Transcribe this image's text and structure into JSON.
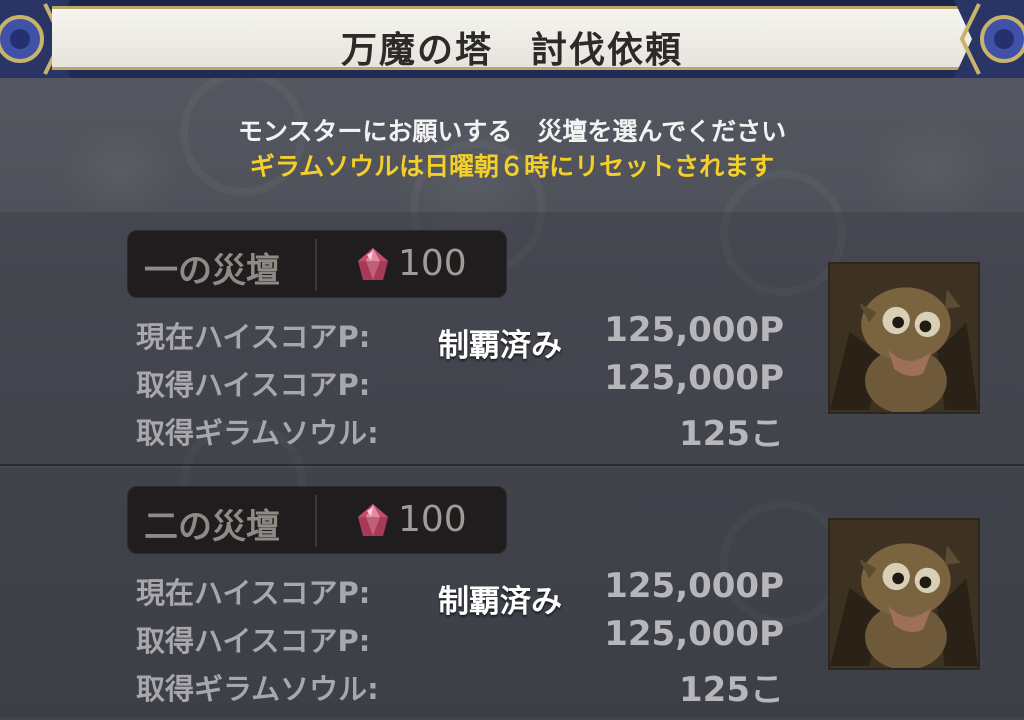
{
  "title": "万魔の塔　討伐依頼",
  "messages": {
    "instruction": "モンスターにお願いする　災壇を選んでください",
    "reset_notice": "ギラムソウルは日曜朝６時にリセットされます"
  },
  "icons": {
    "currency": "pink-gem-icon",
    "portrait": "monster-portrait"
  },
  "colors": {
    "notice": "#f4cf2a",
    "title_frame": "#222b57",
    "gold_trim": "#b9a766"
  },
  "altars": [
    {
      "name": "一の災壇",
      "cost": "100",
      "status": "制覇済み",
      "rows": [
        {
          "label": "現在ハイスコアP:",
          "value": "125,000P"
        },
        {
          "label": "取得ハイスコアP:",
          "value": "125,000P"
        },
        {
          "label": "取得ギラムソウル:",
          "value": "125こ"
        }
      ]
    },
    {
      "name": "二の災壇",
      "cost": "100",
      "status": "制覇済み",
      "rows": [
        {
          "label": "現在ハイスコアP:",
          "value": "125,000P"
        },
        {
          "label": "取得ハイスコアP:",
          "value": "125,000P"
        },
        {
          "label": "取得ギラムソウル:",
          "value": "125こ"
        }
      ]
    }
  ]
}
